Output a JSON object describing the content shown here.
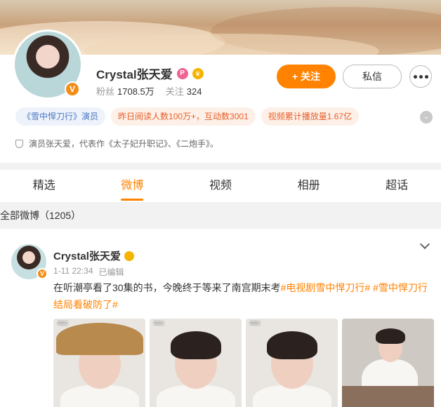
{
  "profile": {
    "name": "Crystal张天爱",
    "fans_label": "粉丝",
    "fans_value": "1708.5万",
    "following_label": "关注",
    "following_value": "324",
    "follow_button": "+ 关注",
    "message_button": "私信",
    "verified_badge": "V"
  },
  "tags": [
    "《雪中悍刀行》演员",
    "昨日阅读人数100万+，互动数3001",
    "视频累计播放量1.67亿"
  ],
  "bio": "演员张天爱，代表作《太子妃升职记》、《二炮手》。",
  "tabs": [
    "精选",
    "微博",
    "视频",
    "相册",
    "超话"
  ],
  "active_tab": "微博",
  "all_posts_label": "全部微博（1205）",
  "post": {
    "author": "Crystal张天爱",
    "time": "1-11 22:34",
    "edited": "已编辑",
    "text_plain": "在听潮亭看了30集的书，今晚终于等来了南宫期末考",
    "hashtag1": "#电视剧雪中悍刀行#",
    "hashtag2": " #雪中悍刀行结局看破防了#",
    "photo_rec_label": "REC"
  },
  "colors": {
    "accent": "#ff8200",
    "tag_blue_text": "#4a78c2",
    "tag_orange_text": "#e8602a"
  },
  "icons": [
    "vip-icon",
    "crown-icon",
    "more-dots-icon",
    "expand-icon",
    "shield-icon",
    "chevron-down-icon"
  ]
}
